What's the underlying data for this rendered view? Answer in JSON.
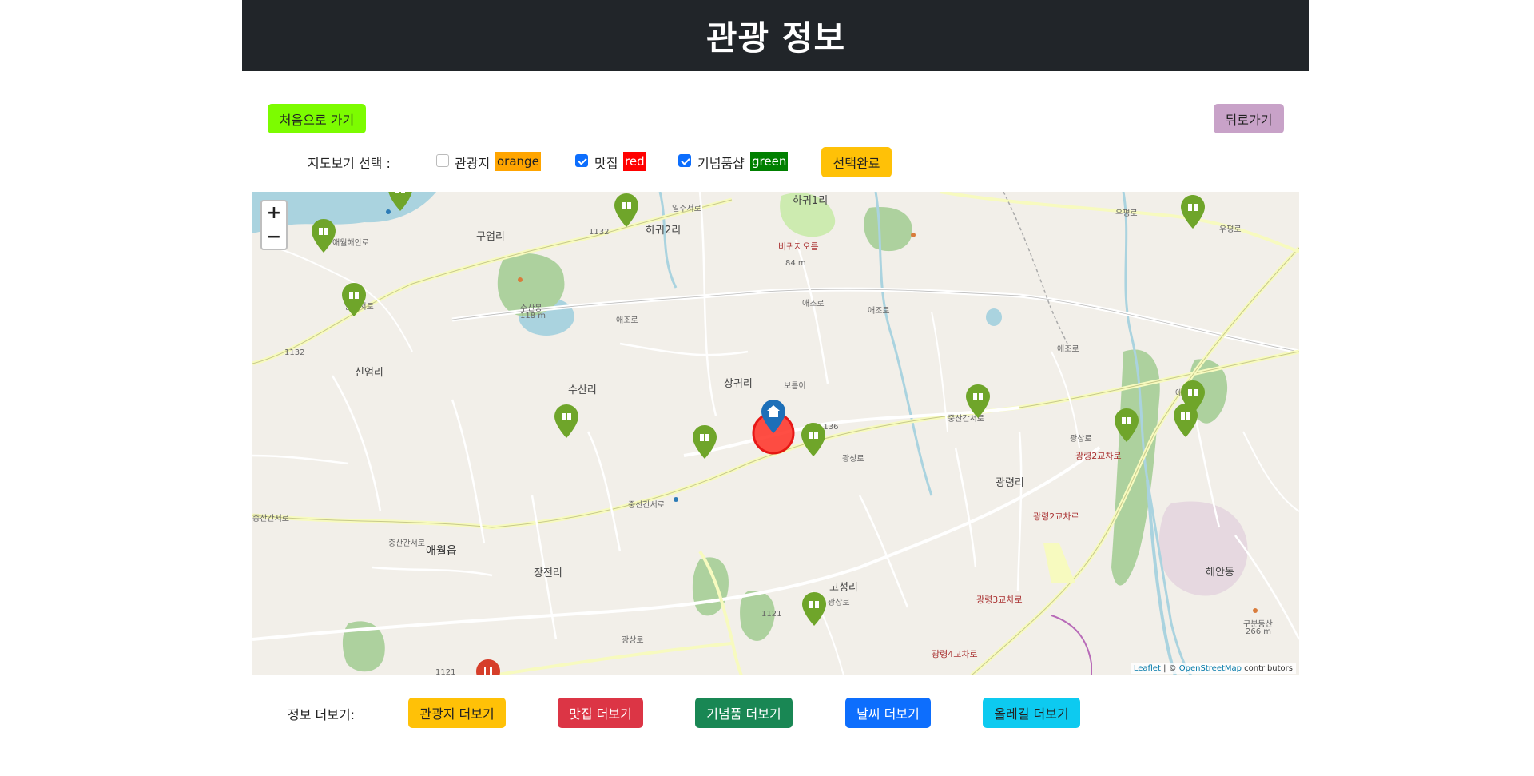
{
  "header": {
    "title": "관광 정보"
  },
  "nav": {
    "home_label": "처음으로 가기",
    "back_label": "뒤로가기"
  },
  "filter": {
    "label": "지도보기 선택 :",
    "options": [
      {
        "label": "관광지",
        "color_label": "orange",
        "color": "#ffa500",
        "checked": false
      },
      {
        "label": "맛집",
        "color_label": "red",
        "color": "#ff0000",
        "checked": true
      },
      {
        "label": "기념품샵",
        "color_label": "green",
        "color": "#008000",
        "checked": true
      }
    ],
    "done_label": "선택완료"
  },
  "map": {
    "zoom_in": "+",
    "zoom_out": "−",
    "attribution": {
      "leaflet": "Leaflet",
      "sep": " | © ",
      "osm": "OpenStreetMap",
      "suffix": " contributors"
    },
    "labels": {
      "guyeomri": "구엄리",
      "hagwi2ri": "하귀2리",
      "hagwi1ri": "하귀1리",
      "bigaeoreum": "비귀지오름",
      "bigae_elev": "84 m",
      "susanbong": "수산봉",
      "susan_elev": "118 m",
      "sinheomri": "신엄리",
      "susanri": "수산리",
      "sanggwiri": "상귀리",
      "boreumi": "보름이",
      "gwangnyeongri": "광령리",
      "aewol": "애월읍",
      "jangjeonri": "장전리",
      "goseongri": "고성리",
      "haeando": "해안동",
      "gubun": "구분동산",
      "gubun_elev": "266 m",
      "gr1": "광령2교차로",
      "gr2": "광령2교차로",
      "gr3": "광령3교차로",
      "gr4": "광령4교차로",
      "road1132a": "1132",
      "road1132b": "1132",
      "road1136": "1136",
      "road1121a": "1121",
      "road1121b": "1121",
      "aejo1": "애조로",
      "aejo2": "애조로",
      "aejo3": "애조로",
      "aejo4": "애조로",
      "aejo5": "애조로",
      "jungsan1": "중산간서로",
      "jungsan2": "중산간서로",
      "jungsan3": "중산간서로",
      "jungsan4": "중산간서로",
      "gwangsang1": "광상로",
      "gwangsang2": "광상로",
      "gwangsang3": "광상로",
      "gwangsang4": "광상로",
      "ilju1": "일주서로",
      "ilju2": "일주서로",
      "aewolhaean": "애월해안로",
      "uphyeong": "우평로",
      "uphyeong2": "우평로"
    }
  },
  "more": {
    "label": "정보 더보기:",
    "buttons": [
      {
        "label": "관광지 더보기",
        "color": "#ffc107"
      },
      {
        "label": "맛집 더보기",
        "color": "#dc3545"
      },
      {
        "label": "기념품 더보기",
        "color": "#198754"
      },
      {
        "label": "날씨 더보기",
        "color": "#0d6efd"
      },
      {
        "label": "올레길 더보기",
        "color": "#0dcaf0"
      }
    ]
  },
  "colors": {
    "header_bg": "#212529",
    "home_btn": "#7cfc00",
    "back_btn": "#c8a2c8",
    "done_btn": "#ffc107",
    "souvenir_pin": "#6fa52a",
    "home_pin": "#1d6fb8",
    "current_location": "#ff3b30",
    "restaurant_pin": "#d63e2a"
  }
}
